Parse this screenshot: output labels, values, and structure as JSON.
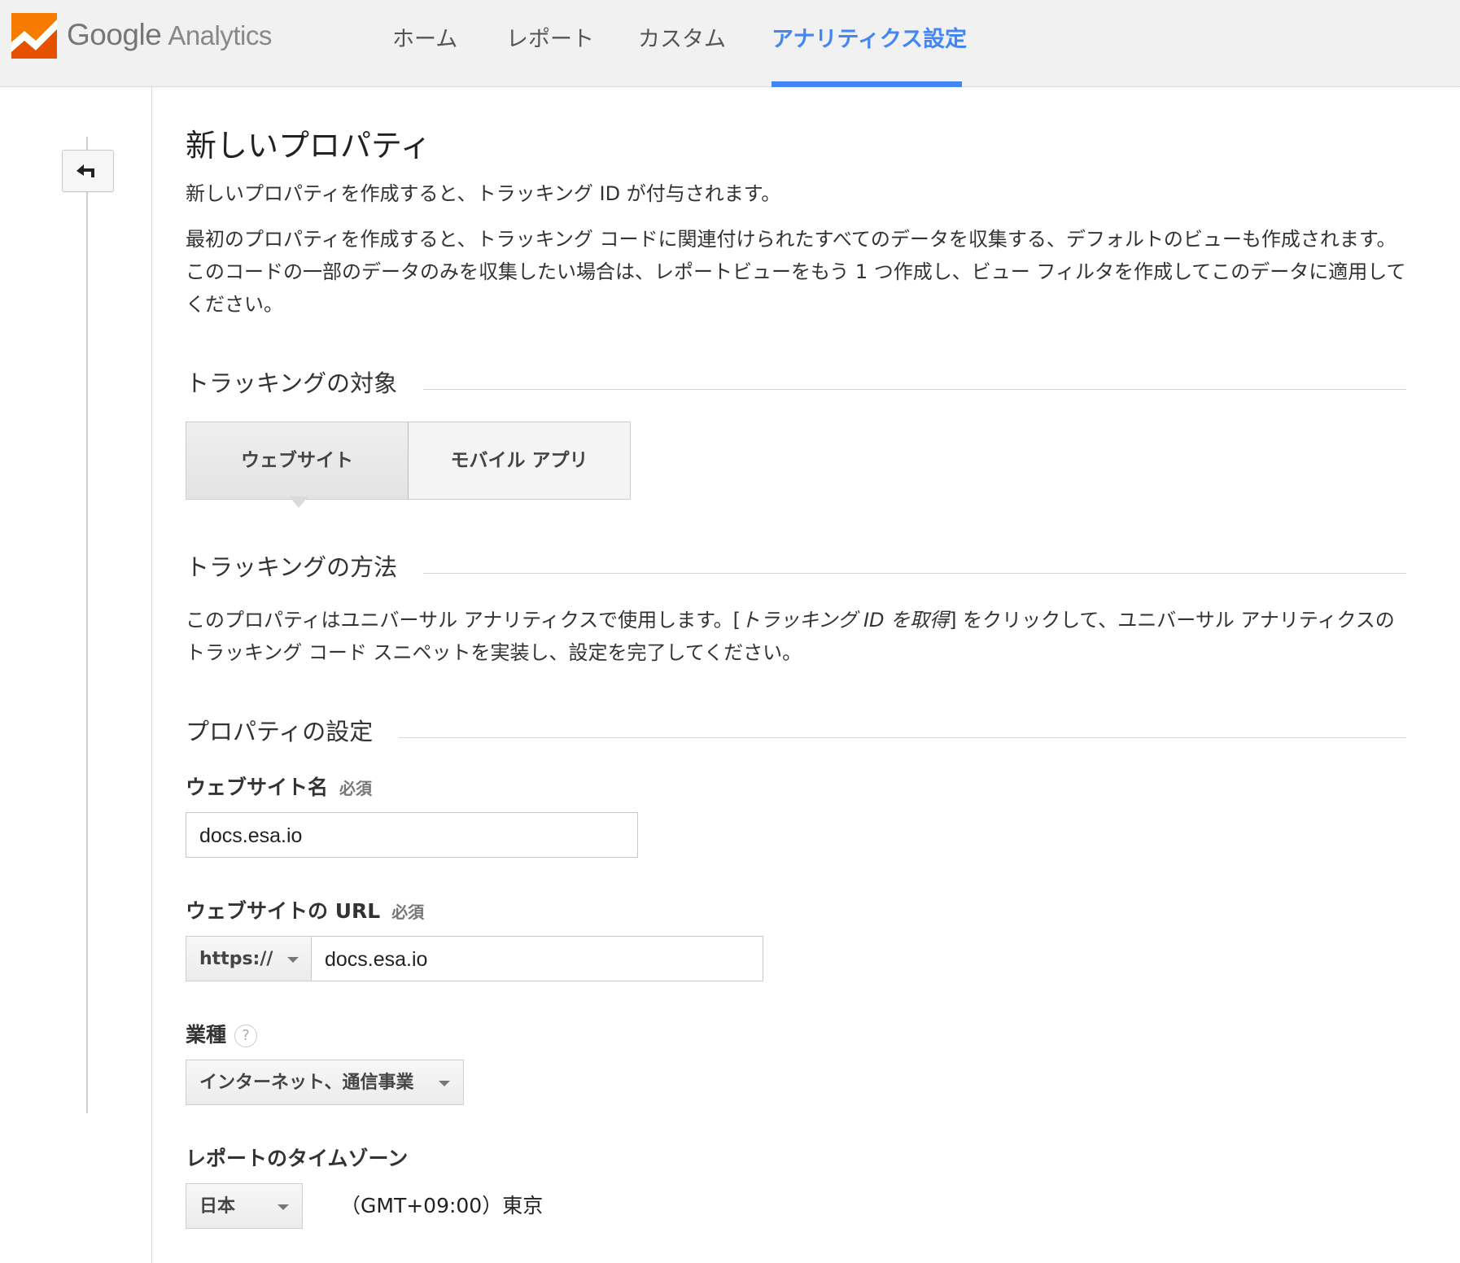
{
  "app": {
    "logo_google": "Google",
    "logo_product": "Analytics",
    "brand_colors": {
      "orange": "#f57c00",
      "accent": "#4285f4"
    }
  },
  "nav": {
    "items": [
      {
        "label": "ホーム",
        "active": false
      },
      {
        "label": "レポート",
        "active": false
      },
      {
        "label": "カスタム",
        "active": false
      },
      {
        "label": "アナリティクス設定",
        "active": true
      }
    ]
  },
  "sidebar": {
    "back_icon": "back-arrow-icon"
  },
  "page": {
    "title": "新しいプロパティ",
    "intro": "新しいプロパティを作成すると、トラッキング ID が付与されます。",
    "description": "最初のプロパティを作成すると、トラッキング コードに関連付けられたすべてのデータを収集する、デフォルトのビューも作成されます。このコードの一部のデータのみを収集したい場合は、レポートビューをもう 1 つ作成し、ビュー フィルタを作成してこのデータに適用してください。"
  },
  "tracking_target": {
    "title": "トラッキングの対象",
    "options": [
      {
        "label": "ウェブサイト",
        "selected": true
      },
      {
        "label": "モバイル アプリ",
        "selected": false
      }
    ]
  },
  "tracking_method": {
    "title": "トラッキングの方法",
    "text_before": "このプロパティはユニバーサル アナリティクスで使用します。[",
    "text_emphasis": "トラッキング ID を取得",
    "text_after": "] をクリックして、ユニバーサル アナリティクスのトラッキング コード スニペットを実装し、設定を完了してください。"
  },
  "property_settings": {
    "title": "プロパティの設定",
    "website_name": {
      "label": "ウェブサイト名",
      "required": "必須",
      "value": "docs.esa.io"
    },
    "website_url": {
      "label": "ウェブサイトの URL",
      "required": "必須",
      "protocol": "https://",
      "value": "docs.esa.io"
    },
    "industry": {
      "label": "業種",
      "help_icon": "?",
      "value": "インターネット、通信事業"
    },
    "timezone": {
      "label": "レポートのタイムゾーン",
      "country": "日本",
      "zone": "（GMT+09:00）東京"
    }
  }
}
